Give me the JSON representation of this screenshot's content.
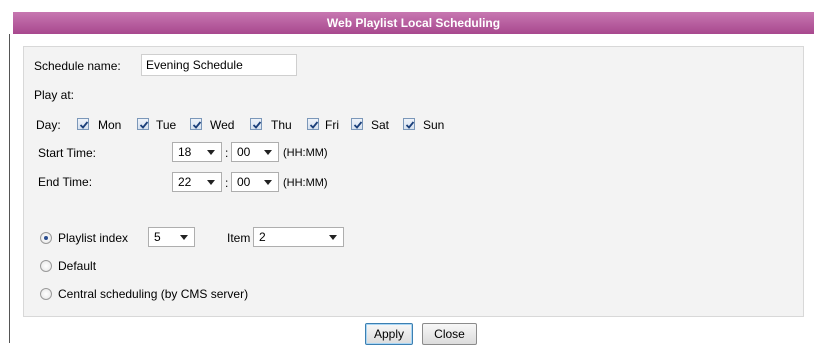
{
  "title": "Web Playlist Local Scheduling",
  "form": {
    "schedule_name_label": "Schedule name:",
    "schedule_name_value": "Evening Schedule",
    "play_at_label": "Play at:",
    "day_label": "Day:",
    "days": [
      {
        "label": "Mon",
        "checked": true
      },
      {
        "label": "Tue",
        "checked": true
      },
      {
        "label": "Wed",
        "checked": true
      },
      {
        "label": "Thu",
        "checked": true
      },
      {
        "label": "Fri",
        "checked": true
      },
      {
        "label": "Sat",
        "checked": true
      },
      {
        "label": "Sun",
        "checked": true
      }
    ],
    "start_time_label": "Start Time:",
    "start_hour": "18",
    "start_minute": "00",
    "end_time_label": "End Time:",
    "end_hour": "22",
    "end_minute": "00",
    "colon": ":",
    "format_hint": "(HH:MM)",
    "playlist_index_label": "Playlist index",
    "playlist_index_value": "5",
    "item_label": "Item",
    "item_value": "2",
    "default_label": "Default",
    "central_label": "Central scheduling (by CMS server)",
    "selected_mode": "playlist"
  },
  "buttons": {
    "apply": "Apply",
    "close": "Close"
  }
}
